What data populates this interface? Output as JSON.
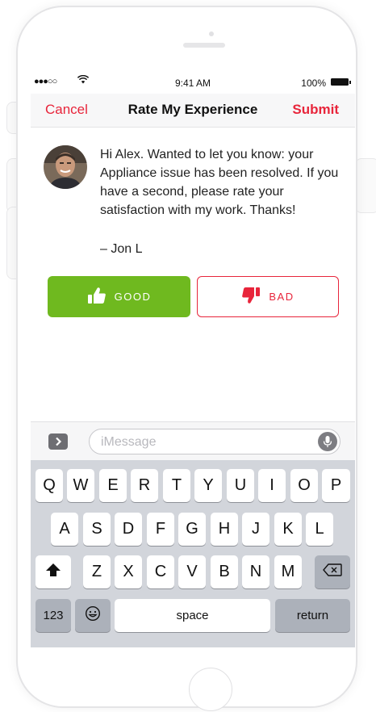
{
  "status_bar": {
    "signal": "●●●○○",
    "time": "9:41 AM",
    "battery_pct": "100%"
  },
  "nav": {
    "cancel_label": "Cancel",
    "title": "Rate My Experience",
    "submit_label": "Submit"
  },
  "message": {
    "body": "Hi Alex. Wanted to let you know: your Appliance issue has been resolved. If you have a second, please rate your satisfaction with my work. Thanks!",
    "signature": "– Jon L"
  },
  "rating": {
    "good_label": "GOOD",
    "bad_label": "BAD"
  },
  "composer": {
    "placeholder": "iMessage"
  },
  "keyboard": {
    "row1": [
      "Q",
      "W",
      "E",
      "R",
      "T",
      "Y",
      "U",
      "I",
      "O",
      "P"
    ],
    "row2": [
      "A",
      "S",
      "D",
      "F",
      "G",
      "H",
      "J",
      "K",
      "L"
    ],
    "row3": [
      "Z",
      "X",
      "C",
      "V",
      "B",
      "N",
      "M"
    ],
    "numbers_label": "123",
    "space_label": "space",
    "return_label": "return"
  },
  "colors": {
    "accent_red": "#e8253b",
    "good_green": "#6fb91f",
    "keyboard_bg": "#d2d5db"
  },
  "icons": {
    "good": "thumbs-up-icon",
    "bad": "thumbs-down-icon",
    "shift": "shift-arrow-icon",
    "delete": "backspace-icon",
    "emoji": "emoji-icon",
    "mic": "microphone-icon",
    "apps": "chevron-right-icon"
  }
}
